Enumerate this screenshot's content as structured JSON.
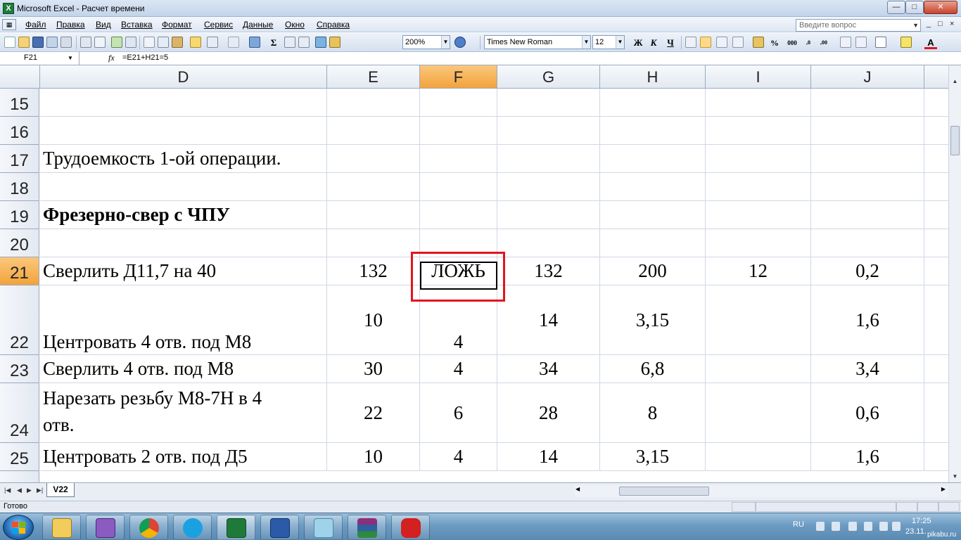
{
  "window": {
    "title": "Microsoft Excel - Расчет времени",
    "minimize": "—",
    "maximize": "□",
    "close": "✕"
  },
  "menu": {
    "items": [
      "Файл",
      "Правка",
      "Вид",
      "Вставка",
      "Формат",
      "Сервис",
      "Данные",
      "Окно",
      "Справка"
    ],
    "question_placeholder": "Введите вопрос",
    "doc_controls": [
      "_",
      "□",
      "×"
    ]
  },
  "toolbar": {
    "zoom": "200%",
    "font_name": "Times New Roman",
    "font_size": "12",
    "bold": "Ж",
    "italic": "К",
    "underline": "Ч",
    "sum": "Σ",
    "percent": "%",
    "thousands": "000",
    "decimal_inc": ",0",
    "decimal_dec": ",00",
    "font_color": "A"
  },
  "formula_bar": {
    "name_box": "F21",
    "fx": "fx",
    "formula": "=E21+H21=5"
  },
  "grid": {
    "columns": [
      "D",
      "E",
      "F",
      "G",
      "H",
      "I",
      "J"
    ],
    "active_column": "F",
    "active_row": "21",
    "rows": [
      {
        "num": "15",
        "D": "",
        "E": "",
        "F": "",
        "G": "",
        "H": "",
        "I": "",
        "J": ""
      },
      {
        "num": "16",
        "D": "",
        "E": "",
        "F": "",
        "G": "",
        "H": "",
        "I": "",
        "J": ""
      },
      {
        "num": "17",
        "D": "Трудоемкость 1-ой  операции.",
        "E": "",
        "F": "",
        "G": "",
        "H": "",
        "I": "",
        "J": ""
      },
      {
        "num": "18",
        "D": "",
        "E": "",
        "F": "",
        "G": "",
        "H": "",
        "I": "",
        "J": ""
      },
      {
        "num": "19",
        "D": "Фрезерно-свер с ЧПУ",
        "E": "",
        "F": "",
        "G": "",
        "H": "",
        "I": "",
        "J": ""
      },
      {
        "num": "20",
        "D": "",
        "E": "",
        "F": "",
        "G": "",
        "H": "",
        "I": "",
        "J": ""
      },
      {
        "num": "21",
        "D": "Сверлить Д11,7 на 40",
        "E": "132",
        "F": "ЛОЖЬ",
        "G": "132",
        "H": "200",
        "I": "12",
        "J": "0,2"
      },
      {
        "num": "22",
        "D": "Центровать 4 отв. под М8",
        "E": "10",
        "F": "4",
        "G": "14",
        "H": "3,15",
        "I": "",
        "J": "1,6"
      },
      {
        "num": "23",
        "D": "Сверлить 4 отв. под М8",
        "E": "30",
        "F": "4",
        "G": "34",
        "H": "6,8",
        "I": "",
        "J": "3,4"
      },
      {
        "num": "24",
        "D": "Нарезать  резьбу  М8-7Н  в  4",
        "D2": "отв.",
        "E": "22",
        "F": "6",
        "G": "28",
        "H": "8",
        "I": "",
        "J": "0,6"
      },
      {
        "num": "25",
        "D": "Центровать 2 отв. под Д5",
        "E": "10",
        "F": "4",
        "G": "14",
        "H": "3,15",
        "I": "",
        "J": "1,6"
      }
    ]
  },
  "sheet_tabs": {
    "active": "V22"
  },
  "status": {
    "text": "Готово"
  },
  "taskbar": {
    "language": "RU",
    "time": "17:25",
    "date": "23.11.",
    "watermark": "pikabu.ru"
  },
  "colors": {
    "selection_highlight": "#e2141e",
    "active_header": "#f2a33b",
    "excel_green": "#1f7a3a"
  }
}
